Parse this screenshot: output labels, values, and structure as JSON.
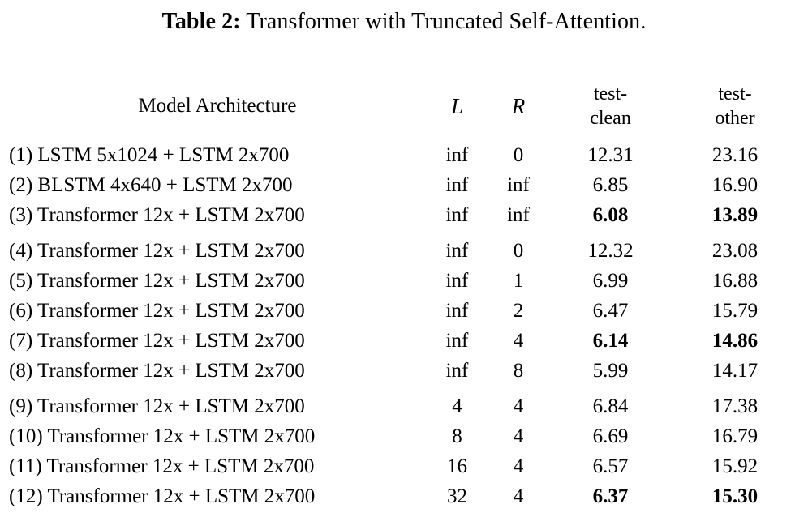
{
  "caption": {
    "label": "Table 2:",
    "text": " Transformer with Truncated Self-Attention."
  },
  "table": {
    "headers": {
      "model": "Model Architecture",
      "l": "L",
      "r": "R",
      "test_clean_line1": "test-",
      "test_clean_line2": "clean",
      "test_other_line1": "test-",
      "test_other_line2": "other"
    },
    "groups": [
      {
        "rows": [
          {
            "model": "(1) LSTM 5x1024 + LSTM 2x700",
            "l": "inf",
            "r": "0",
            "test_clean": "12.31",
            "test_other": "23.16",
            "bold": false
          },
          {
            "model": "(2) BLSTM 4x640 + LSTM 2x700",
            "l": "inf",
            "r": "inf",
            "test_clean": "6.85",
            "test_other": "16.90",
            "bold": false
          },
          {
            "model": "(3) Transformer 12x + LSTM 2x700",
            "l": "inf",
            "r": "inf",
            "test_clean": "6.08",
            "test_other": "13.89",
            "bold": true
          }
        ]
      },
      {
        "rows": [
          {
            "model": "(4) Transformer 12x + LSTM 2x700",
            "l": "inf",
            "r": "0",
            "test_clean": "12.32",
            "test_other": "23.08",
            "bold": false
          },
          {
            "model": "(5) Transformer 12x + LSTM 2x700",
            "l": "inf",
            "r": "1",
            "test_clean": "6.99",
            "test_other": "16.88",
            "bold": false
          },
          {
            "model": "(6) Transformer 12x + LSTM 2x700",
            "l": "inf",
            "r": "2",
            "test_clean": "6.47",
            "test_other": "15.79",
            "bold": false
          },
          {
            "model": "(7) Transformer 12x + LSTM 2x700",
            "l": "inf",
            "r": "4",
            "test_clean": "6.14",
            "test_other": "14.86",
            "bold": true
          },
          {
            "model": "(8) Transformer 12x + LSTM 2x700",
            "l": "inf",
            "r": "8",
            "test_clean": "5.99",
            "test_other": "14.17",
            "bold": false
          }
        ]
      },
      {
        "rows": [
          {
            "model": "(9) Transformer 12x + LSTM 2x700",
            "l": "4",
            "r": "4",
            "test_clean": "6.84",
            "test_other": "17.38",
            "bold": false
          },
          {
            "model": "(10) Transformer 12x + LSTM 2x700",
            "l": "8",
            "r": "4",
            "test_clean": "6.69",
            "test_other": "16.79",
            "bold": false
          },
          {
            "model": "(11) Transformer 12x + LSTM 2x700",
            "l": "16",
            "r": "4",
            "test_clean": "6.57",
            "test_other": "15.92",
            "bold": false
          },
          {
            "model": "(12) Transformer 12x + LSTM 2x700",
            "l": "32",
            "r": "4",
            "test_clean": "6.37",
            "test_other": "15.30",
            "bold": true
          }
        ]
      }
    ]
  },
  "colors": {
    "rule": "#555a5e",
    "vrule": "#6a6f73",
    "text": "#000000",
    "background": "#ffffff"
  }
}
